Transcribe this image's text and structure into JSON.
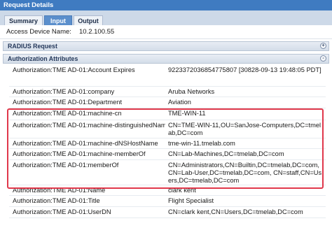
{
  "header": {
    "title": "Request Details"
  },
  "tabs": [
    {
      "label": "Summary"
    },
    {
      "label": "Input"
    },
    {
      "label": "Output"
    }
  ],
  "access_device": {
    "label": "Access Device Name:",
    "value": "10.2.100.55"
  },
  "sections": {
    "radius": {
      "title": "RADIUS Request",
      "toggle": "+"
    },
    "authorization": {
      "title": "Authorization Attributes",
      "toggle": "-"
    }
  },
  "attributes": [
    {
      "key": "Authorization:TME AD-01:Account Expires",
      "value": "9223372036854775807 [30828-09-13 19:48:05 PDT]"
    },
    {
      "key": "Authorization:TME AD-01:company",
      "value": "Aruba Networks"
    },
    {
      "key": "Authorization:TME AD-01:Department",
      "value": "Aviation"
    },
    {
      "key": "Authorization:TME AD-01:machine-cn",
      "value": "TME-WIN-11"
    },
    {
      "key": "Authorization:TME AD-01:machine-distinguishedName",
      "value": "CN=TME-WIN-11,OU=SanJose-Computers,DC=tmelab,DC=com"
    },
    {
      "key": "Authorization:TME AD-01:machine-dNSHostName",
      "value": "tme-win-11.tmelab.com"
    },
    {
      "key": "Authorization:TME AD-01:machine-memberOf",
      "value": "CN=Lab-Machines,DC=tmelab,DC=com"
    },
    {
      "key": "Authorization:TME AD-01:memberOf",
      "value": "CN=Administrators,CN=Builtin,DC=tmelab,DC=com, CN=Lab-User,DC=tmelab,DC=com, CN=staff,CN=Users,DC=tmelab,DC=com"
    },
    {
      "key": "Authorization:TME AD-01:Name",
      "value": "clark kent"
    },
    {
      "key": "Authorization:TME AD-01:Title",
      "value": "Flight Specialist"
    },
    {
      "key": "Authorization:TME AD-01:UserDN",
      "value": "CN=clark kent,CN=Users,DC=tmelab,DC=com"
    }
  ],
  "colors": {
    "title_bar": "#3f7bc1",
    "active_tab": "#5b8fcc",
    "highlight": "#e0384b"
  }
}
